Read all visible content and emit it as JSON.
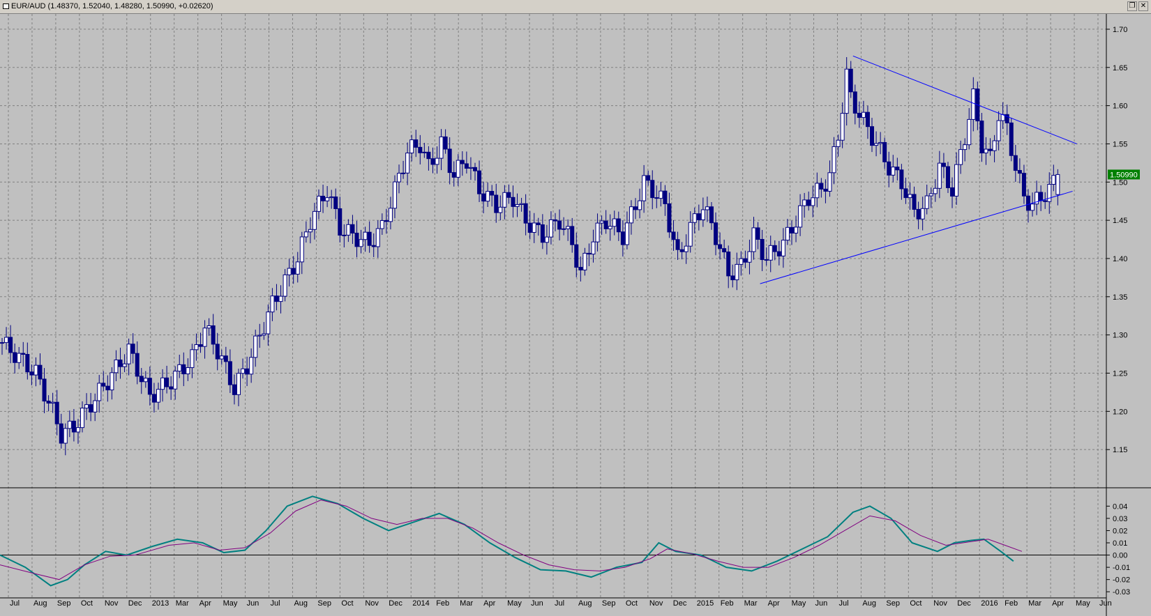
{
  "window": {
    "title": "EUR/AUD (1.48370, 1.52040, 1.48280, 1.50990, +0.02620)",
    "restore_icon": "restore-icon",
    "close_icon": "close-icon"
  },
  "chart_data": [
    {
      "type": "candlestick",
      "symbol": "EUR/AUD",
      "open": 1.4837,
      "high": 1.5204,
      "low": 1.4828,
      "close": 1.5099,
      "change": 0.0262,
      "last_price_label": "1.50990",
      "ylim": [
        1.1,
        1.72
      ],
      "yticks": [
        "1.70",
        "1.65",
        "1.60",
        "1.55",
        "1.50",
        "1.45",
        "1.40",
        "1.35",
        "1.30",
        "1.25",
        "1.20",
        "1.15"
      ],
      "xticks": [
        "Jul",
        "Aug",
        "Sep",
        "Oct",
        "Nov",
        "Dec",
        "2013",
        "Mar",
        "Apr",
        "May",
        "Jun",
        "Jul",
        "Aug",
        "Sep",
        "Oct",
        "Nov",
        "Dec",
        "2014",
        "Feb",
        "Mar",
        "Apr",
        "May",
        "Jun",
        "Jul",
        "Aug",
        "Sep",
        "Oct",
        "Nov",
        "Dec",
        "2015",
        "Feb",
        "Mar",
        "Apr",
        "May",
        "Jun",
        "Jul",
        "Aug",
        "Sep",
        "Oct",
        "Nov",
        "Dec",
        "2016",
        "Feb",
        "Mar",
        "Apr",
        "May",
        "Jun"
      ],
      "close_path": [
        [
          0,
          1.29
        ],
        [
          8,
          1.25
        ],
        [
          12,
          1.2
        ],
        [
          14,
          1.17
        ],
        [
          17,
          1.18
        ],
        [
          21,
          1.21
        ],
        [
          25,
          1.24
        ],
        [
          30,
          1.28
        ],
        [
          35,
          1.22
        ],
        [
          40,
          1.24
        ],
        [
          45,
          1.27
        ],
        [
          48,
          1.31
        ],
        [
          51,
          1.28
        ],
        [
          55,
          1.23
        ],
        [
          58,
          1.26
        ],
        [
          61,
          1.3
        ],
        [
          64,
          1.34
        ],
        [
          67,
          1.37
        ],
        [
          70,
          1.4
        ],
        [
          73,
          1.45
        ],
        [
          77,
          1.49
        ],
        [
          80,
          1.44
        ],
        [
          83,
          1.43
        ],
        [
          87,
          1.42
        ],
        [
          90,
          1.44
        ],
        [
          93,
          1.49
        ],
        [
          96,
          1.54
        ],
        [
          99,
          1.55
        ],
        [
          101,
          1.52
        ],
        [
          104,
          1.55
        ],
        [
          107,
          1.51
        ],
        [
          110,
          1.53
        ],
        [
          113,
          1.49
        ],
        [
          117,
          1.47
        ],
        [
          121,
          1.48
        ],
        [
          124,
          1.45
        ],
        [
          128,
          1.43
        ],
        [
          132,
          1.45
        ],
        [
          135,
          1.42
        ],
        [
          137,
          1.38
        ],
        [
          140,
          1.43
        ],
        [
          143,
          1.45
        ],
        [
          147,
          1.43
        ],
        [
          150,
          1.47
        ],
        [
          152,
          1.5
        ],
        [
          154,
          1.49
        ],
        [
          157,
          1.47
        ],
        [
          160,
          1.4
        ],
        [
          163,
          1.44
        ],
        [
          166,
          1.47
        ],
        [
          169,
          1.43
        ],
        [
          172,
          1.38
        ],
        [
          175,
          1.39
        ],
        [
          178,
          1.43
        ],
        [
          181,
          1.4
        ],
        [
          185,
          1.42
        ],
        [
          188,
          1.45
        ],
        [
          191,
          1.48
        ],
        [
          194,
          1.49
        ],
        [
          196,
          1.51
        ],
        [
          198,
          1.56
        ],
        [
          200,
          1.64
        ],
        [
          201,
          1.61
        ],
        [
          204,
          1.58
        ],
        [
          207,
          1.55
        ],
        [
          210,
          1.52
        ],
        [
          213,
          1.5
        ],
        [
          216,
          1.46
        ],
        [
          219,
          1.47
        ],
        [
          222,
          1.52
        ],
        [
          225,
          1.49
        ],
        [
          228,
          1.56
        ],
        [
          230,
          1.61
        ],
        [
          232,
          1.55
        ],
        [
          234,
          1.53
        ],
        [
          236,
          1.59
        ],
        [
          238,
          1.57
        ],
        [
          240,
          1.52
        ],
        [
          242,
          1.48
        ],
        [
          244,
          1.47
        ],
        [
          246,
          1.48
        ],
        [
          248,
          1.49
        ],
        [
          250,
          1.51
        ]
      ],
      "trend_lines": [
        {
          "from": [
            202,
            1.665
          ],
          "to": [
            255,
            1.55
          ]
        },
        {
          "from": [
            180,
            1.367
          ],
          "to": [
            254,
            1.488
          ]
        }
      ]
    },
    {
      "type": "line",
      "ylim": [
        -0.035,
        0.055
      ],
      "yticks": [
        "0.04",
        "0.03",
        "0.02",
        "0.01",
        "0.00",
        "-0.01",
        "-0.02",
        "-0.03"
      ],
      "series": [
        {
          "color": "#008080",
          "points": [
            [
              0,
              0.0
            ],
            [
              6,
              -0.01
            ],
            [
              12,
              -0.025
            ],
            [
              16,
              -0.02
            ],
            [
              20,
              -0.008
            ],
            [
              25,
              0.003
            ],
            [
              30,
              0.0
            ],
            [
              36,
              0.007
            ],
            [
              42,
              0.013
            ],
            [
              48,
              0.01
            ],
            [
              53,
              0.002
            ],
            [
              58,
              0.004
            ],
            [
              63,
              0.02
            ],
            [
              68,
              0.04
            ],
            [
              74,
              0.048
            ],
            [
              80,
              0.042
            ],
            [
              86,
              0.03
            ],
            [
              92,
              0.02
            ],
            [
              98,
              0.027
            ],
            [
              104,
              0.034
            ],
            [
              110,
              0.025
            ],
            [
              116,
              0.01
            ],
            [
              122,
              -0.002
            ],
            [
              128,
              -0.012
            ],
            [
              134,
              -0.013
            ],
            [
              140,
              -0.018
            ],
            [
              146,
              -0.01
            ],
            [
              152,
              -0.006
            ],
            [
              156,
              0.01
            ],
            [
              160,
              0.003
            ],
            [
              166,
              0.0
            ],
            [
              172,
              -0.01
            ],
            [
              178,
              -0.013
            ],
            [
              184,
              -0.005
            ],
            [
              190,
              0.005
            ],
            [
              196,
              0.015
            ],
            [
              202,
              0.035
            ],
            [
              206,
              0.04
            ],
            [
              211,
              0.03
            ],
            [
              216,
              0.01
            ],
            [
              222,
              0.003
            ],
            [
              226,
              0.01
            ],
            [
              230,
              0.012
            ],
            [
              233,
              0.013
            ],
            [
              237,
              0.003
            ],
            [
              240,
              -0.005
            ]
          ]
        },
        {
          "color": "#800080",
          "points": [
            [
              0,
              -0.008
            ],
            [
              8,
              -0.015
            ],
            [
              14,
              -0.02
            ],
            [
              20,
              -0.008
            ],
            [
              26,
              -0.001
            ],
            [
              32,
              0.0
            ],
            [
              40,
              0.008
            ],
            [
              46,
              0.01
            ],
            [
              52,
              0.004
            ],
            [
              58,
              0.006
            ],
            [
              64,
              0.018
            ],
            [
              70,
              0.036
            ],
            [
              76,
              0.045
            ],
            [
              82,
              0.04
            ],
            [
              88,
              0.03
            ],
            [
              94,
              0.025
            ],
            [
              100,
              0.03
            ],
            [
              106,
              0.03
            ],
            [
              112,
              0.022
            ],
            [
              118,
              0.01
            ],
            [
              124,
              0.0
            ],
            [
              130,
              -0.008
            ],
            [
              136,
              -0.012
            ],
            [
              142,
              -0.013
            ],
            [
              148,
              -0.01
            ],
            [
              154,
              -0.003
            ],
            [
              158,
              0.005
            ],
            [
              164,
              0.001
            ],
            [
              170,
              -0.005
            ],
            [
              176,
              -0.01
            ],
            [
              182,
              -0.01
            ],
            [
              188,
              -0.002
            ],
            [
              194,
              0.008
            ],
            [
              200,
              0.02
            ],
            [
              206,
              0.032
            ],
            [
              212,
              0.028
            ],
            [
              218,
              0.016
            ],
            [
              224,
              0.008
            ],
            [
              228,
              0.01
            ],
            [
              234,
              0.013
            ],
            [
              238,
              0.008
            ],
            [
              242,
              0.003
            ]
          ]
        }
      ]
    }
  ]
}
